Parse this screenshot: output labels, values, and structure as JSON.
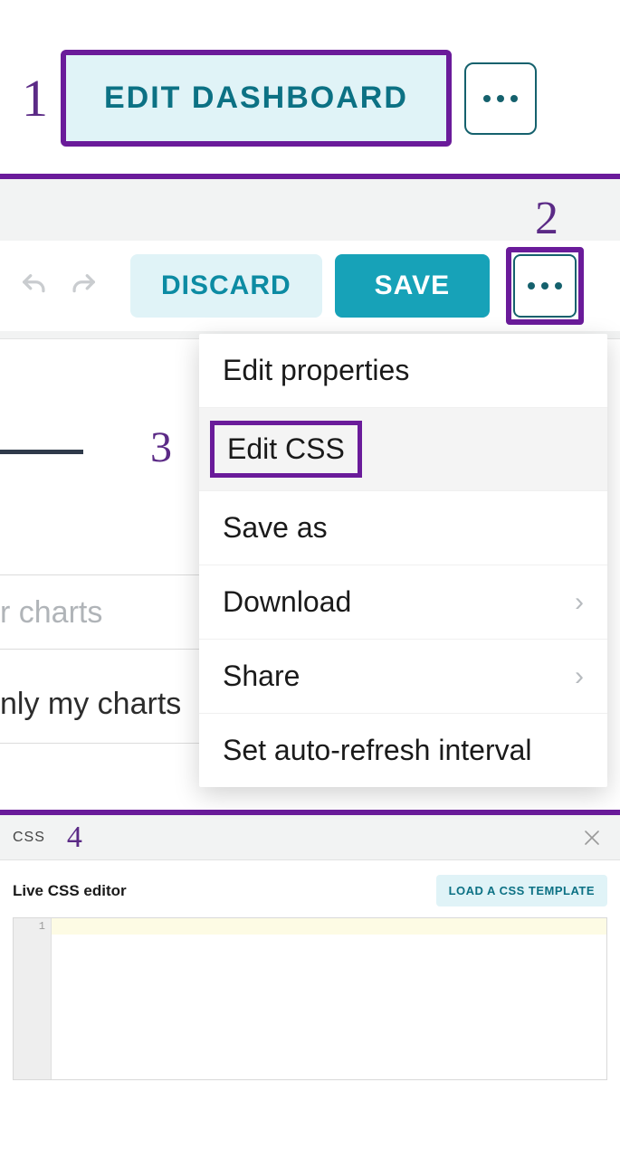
{
  "steps": {
    "s1": "1",
    "s2": "2",
    "s3": "3",
    "s4": "4"
  },
  "section1": {
    "edit_dashboard": "EDIT DASHBOARD"
  },
  "toolbar": {
    "discard": "DISCARD",
    "save": "SAVE"
  },
  "menu": {
    "edit_properties": "Edit properties",
    "edit_css": "Edit CSS",
    "save_as": "Save as",
    "download": "Download",
    "share": "Share",
    "auto_refresh": "Set auto-refresh interval"
  },
  "background": {
    "filter_charts": "r charts",
    "only_my_charts": "nly my charts"
  },
  "css_panel": {
    "header": "CSS",
    "live_editor": "Live CSS editor",
    "load_template": "LOAD A CSS TEMPLATE",
    "line1": "1"
  }
}
